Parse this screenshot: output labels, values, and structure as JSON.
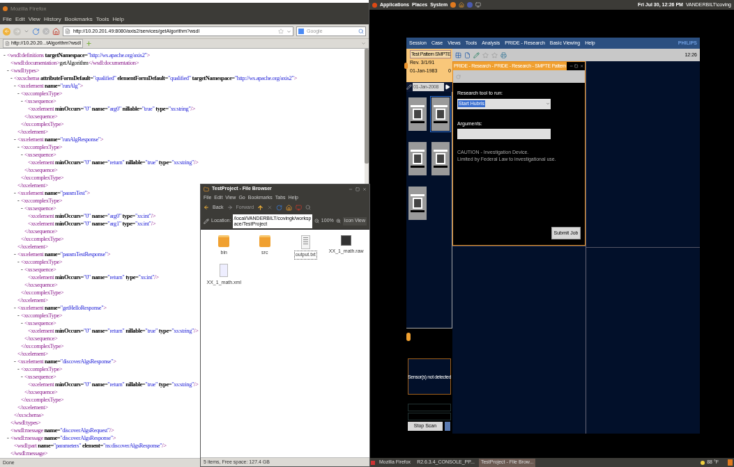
{
  "firefox": {
    "title": "Mozilla Firefox",
    "menus": [
      "File",
      "Edit",
      "View",
      "History",
      "Bookmarks",
      "Tools",
      "Help"
    ],
    "url": "http://10.20.201.49:8080/axis2/services/getAlgorithm?wsdl",
    "search": {
      "placeholder": "Google"
    },
    "tab": {
      "label": "http://10.20.20...tAlgorithm?wsdl",
      "selected": true
    },
    "status": "Done",
    "xml": [
      {
        "toggle": "-",
        "tag": "<wsdl:definitions",
        "attrs": [
          {
            "name": "targetNamespace=",
            "value": "\"http://ws.apache.org/axis2\""
          }
        ],
        "end": ">",
        "children": [
          {
            "tag": "<wsdl:documentation",
            "end": ">",
            "text": "getAlgorithm",
            "close": "</wsdl:documentation>"
          },
          {
            "toggle": "-",
            "tag": "<wsdl:types",
            "end": ">",
            "children": [
              {
                "toggle": "-",
                "tag": "<xs:schema",
                "attrs": [
                  {
                    "name": "attributeFormDefault=",
                    "value": "\"qualified\""
                  },
                  {
                    "name": "elementFormDefault=",
                    "value": "\"qualified\""
                  },
                  {
                    "name": "targetNamespace=",
                    "value": "\"http://ws.apache.org/axis2\""
                  }
                ],
                "end": ">",
                "children": [
                  {
                    "toggle": "-",
                    "tag": "<xs:element",
                    "attrs": [
                      {
                        "name": "name=",
                        "value": "\"runAlg\""
                      }
                    ],
                    "end": ">",
                    "children": [
                      {
                        "toggle": "-",
                        "tag": "<xs:complexType",
                        "end": ">",
                        "children": [
                          {
                            "toggle": "-",
                            "tag": "<xs:sequence",
                            "end": ">",
                            "children": [
                              {
                                "tag": "<xs:element",
                                "attrs": [
                                  {
                                    "name": "minOccurs=",
                                    "value": "\"0\""
                                  },
                                  {
                                    "name": "name=",
                                    "value": "\"arg0\""
                                  },
                                  {
                                    "name": "nillable=",
                                    "value": "\"true\""
                                  },
                                  {
                                    "name": "type=",
                                    "value": "\"xs:string\""
                                  }
                                ],
                                "end": "/>"
                              }
                            ],
                            "close": "</xs:sequence>"
                          }
                        ],
                        "close": "</xs:complexType>"
                      }
                    ],
                    "close": "</xs:element>"
                  },
                  {
                    "toggle": "-",
                    "tag": "<xs:element",
                    "attrs": [
                      {
                        "name": "name=",
                        "value": "\"runAlgResponse\""
                      }
                    ],
                    "end": ">",
                    "children": [
                      {
                        "toggle": "-",
                        "tag": "<xs:complexType",
                        "end": ">",
                        "children": [
                          {
                            "toggle": "-",
                            "tag": "<xs:sequence",
                            "end": ">",
                            "children": [
                              {
                                "tag": "<xs:element",
                                "attrs": [
                                  {
                                    "name": "minOccurs=",
                                    "value": "\"0\""
                                  },
                                  {
                                    "name": "name=",
                                    "value": "\"return\""
                                  },
                                  {
                                    "name": "nillable=",
                                    "value": "\"true\""
                                  },
                                  {
                                    "name": "type=",
                                    "value": "\"xs:string\""
                                  }
                                ],
                                "end": "/>"
                              }
                            ],
                            "close": "</xs:sequence>"
                          }
                        ],
                        "close": "</xs:complexType>"
                      }
                    ],
                    "close": "</xs:element>"
                  },
                  {
                    "toggle": "-",
                    "tag": "<xs:element",
                    "attrs": [
                      {
                        "name": "name=",
                        "value": "\"paramTest\""
                      }
                    ],
                    "end": ">",
                    "children": [
                      {
                        "toggle": "-",
                        "tag": "<xs:complexType",
                        "end": ">",
                        "children": [
                          {
                            "toggle": "-",
                            "tag": "<xs:sequence",
                            "end": ">",
                            "children": [
                              {
                                "tag": "<xs:element",
                                "attrs": [
                                  {
                                    "name": "minOccurs=",
                                    "value": "\"0\""
                                  },
                                  {
                                    "name": "name=",
                                    "value": "\"arg0\""
                                  },
                                  {
                                    "name": "type=",
                                    "value": "\"xs:int\""
                                  }
                                ],
                                "end": "/>"
                              },
                              {
                                "tag": "<xs:element",
                                "attrs": [
                                  {
                                    "name": "minOccurs=",
                                    "value": "\"0\""
                                  },
                                  {
                                    "name": "name=",
                                    "value": "\"arg1\""
                                  },
                                  {
                                    "name": "type=",
                                    "value": "\"xs:int\""
                                  }
                                ],
                                "end": "/>"
                              }
                            ],
                            "close": "</xs:sequence>"
                          }
                        ],
                        "close": "</xs:complexType>"
                      }
                    ],
                    "close": "</xs:element>"
                  },
                  {
                    "toggle": "-",
                    "tag": "<xs:element",
                    "attrs": [
                      {
                        "name": "name=",
                        "value": "\"paramTestResponse\""
                      }
                    ],
                    "end": ">",
                    "children": [
                      {
                        "toggle": "-",
                        "tag": "<xs:complexType",
                        "end": ">",
                        "children": [
                          {
                            "toggle": "-",
                            "tag": "<xs:sequence",
                            "end": ">",
                            "children": [
                              {
                                "tag": "<xs:element",
                                "attrs": [
                                  {
                                    "name": "minOccurs=",
                                    "value": "\"0\""
                                  },
                                  {
                                    "name": "name=",
                                    "value": "\"return\""
                                  },
                                  {
                                    "name": "type=",
                                    "value": "\"xs:int\""
                                  }
                                ],
                                "end": "/>"
                              }
                            ],
                            "close": "</xs:sequence>"
                          }
                        ],
                        "close": "</xs:complexType>"
                      }
                    ],
                    "close": "</xs:element>"
                  },
                  {
                    "toggle": "-",
                    "tag": "<xs:element",
                    "attrs": [
                      {
                        "name": "name=",
                        "value": "\"getHelloResponse\""
                      }
                    ],
                    "end": ">",
                    "children": [
                      {
                        "toggle": "-",
                        "tag": "<xs:complexType",
                        "end": ">",
                        "children": [
                          {
                            "toggle": "-",
                            "tag": "<xs:sequence",
                            "end": ">",
                            "children": [
                              {
                                "tag": "<xs:element",
                                "attrs": [
                                  {
                                    "name": "minOccurs=",
                                    "value": "\"0\""
                                  },
                                  {
                                    "name": "name=",
                                    "value": "\"return\""
                                  },
                                  {
                                    "name": "nillable=",
                                    "value": "\"true\""
                                  },
                                  {
                                    "name": "type=",
                                    "value": "\"xs:string\""
                                  }
                                ],
                                "end": "/>"
                              }
                            ],
                            "close": "</xs:sequence>"
                          }
                        ],
                        "close": "</xs:complexType>"
                      }
                    ],
                    "close": "</xs:element>"
                  },
                  {
                    "toggle": "-",
                    "tag": "<xs:element",
                    "attrs": [
                      {
                        "name": "name=",
                        "value": "\"discoverAlgsResponse\""
                      }
                    ],
                    "end": ">",
                    "children": [
                      {
                        "toggle": "-",
                        "tag": "<xs:complexType",
                        "end": ">",
                        "children": [
                          {
                            "toggle": "-",
                            "tag": "<xs:sequence",
                            "end": ">",
                            "children": [
                              {
                                "tag": "<xs:element",
                                "attrs": [
                                  {
                                    "name": "minOccurs=",
                                    "value": "\"0\""
                                  },
                                  {
                                    "name": "name=",
                                    "value": "\"return\""
                                  },
                                  {
                                    "name": "nillable=",
                                    "value": "\"true\""
                                  },
                                  {
                                    "name": "type=",
                                    "value": "\"xs:string\""
                                  }
                                ],
                                "end": "/>"
                              }
                            ],
                            "close": "</xs:sequence>"
                          }
                        ],
                        "close": "</xs:complexType>"
                      }
                    ],
                    "close": "</xs:element>"
                  }
                ],
                "close": "</xs:schema>"
              }
            ],
            "close": "</wsdl:types>"
          },
          {
            "tag": "<wsdl:message",
            "attrs": [
              {
                "name": "name=",
                "value": "\"discoverAlgsRequest\""
              }
            ],
            "end": "/>"
          },
          {
            "toggle": "-",
            "tag": "<wsdl:message",
            "attrs": [
              {
                "name": "name=",
                "value": "\"discoverAlgsResponse\""
              }
            ],
            "end": ">",
            "children": [
              {
                "tag": "<wsdl:part",
                "attrs": [
                  {
                    "name": "name=",
                    "value": "\"parameters\""
                  },
                  {
                    "name": "element=",
                    "value": "\"ns:discoverAlgsResponse\""
                  }
                ],
                "end": "/>"
              }
            ],
            "close": "</wsdl:message>"
          }
        ]
      }
    ]
  },
  "top_panel": {
    "menus": [
      "Applications",
      "Places",
      "System"
    ],
    "clock": "Fri Jul 30, 12:26 PM",
    "user": "VANDERBILT\\coving"
  },
  "philips": {
    "menus": [
      "Session",
      "Case",
      "Views",
      "Tools",
      "Analysis",
      "PRIDE - Research",
      "Basic Viewing",
      "Help"
    ],
    "brand": "PHILIPS",
    "time": "12:26",
    "patient": {
      "name": "Test Pattern SMPTE",
      "rev": "Rev. 3/1/91",
      "date": "01-Jan-1983",
      "count": "0"
    },
    "exam_date": "01-Jan-2008",
    "thumbnails": [
      {
        "selected": false
      },
      {
        "selected": true
      },
      {
        "selected": false
      },
      {
        "selected": false
      },
      {
        "selected": false
      }
    ],
    "dialog": {
      "title": "PRIDE - Research - PRIDE - Research - SMPTE Pattern",
      "tool_label": "Research tool to run:",
      "tool_value": "Start Hubris",
      "args_label": "Arguments:",
      "caution": [
        "CAUTION - Investigation Device.",
        "Limited by Federal Law to investigational use."
      ],
      "submit": "Submit Job"
    },
    "sensor_message": "Sensor(s) not detected",
    "stop_button": "Stop Scan"
  },
  "file_browser": {
    "title": "TestProject - File Browser",
    "menus": [
      "File",
      "Edit",
      "View",
      "Go",
      "Bookmarks",
      "Tabs",
      "Help"
    ],
    "back": "Back",
    "forward": "Forward",
    "location_label": "Location:",
    "path": "/local/VANDERBILT/covingk/workspace/TestProject",
    "zoom": "100%",
    "view": "Icon View",
    "files": [
      {
        "name": "bin",
        "kind": "folder",
        "selected": false
      },
      {
        "name": "src",
        "kind": "folder",
        "selected": false
      },
      {
        "name": "output.txt",
        "kind": "text",
        "selected": true
      },
      {
        "name": "XX_1_math.raw",
        "kind": "image",
        "selected": false
      },
      {
        "name": "XX_1_math.xml",
        "kind": "document",
        "selected": false
      }
    ],
    "status": "5 items, Free space: 127.4 GB"
  },
  "taskbar": {
    "items": [
      {
        "label": "Mozilla Firefox",
        "selected": false
      },
      {
        "label": "R2.6.3.4_CONSOLE_PP...",
        "selected": false
      },
      {
        "label": "TestProject - File Brow...",
        "selected": true
      }
    ],
    "weather": "88 °F"
  }
}
